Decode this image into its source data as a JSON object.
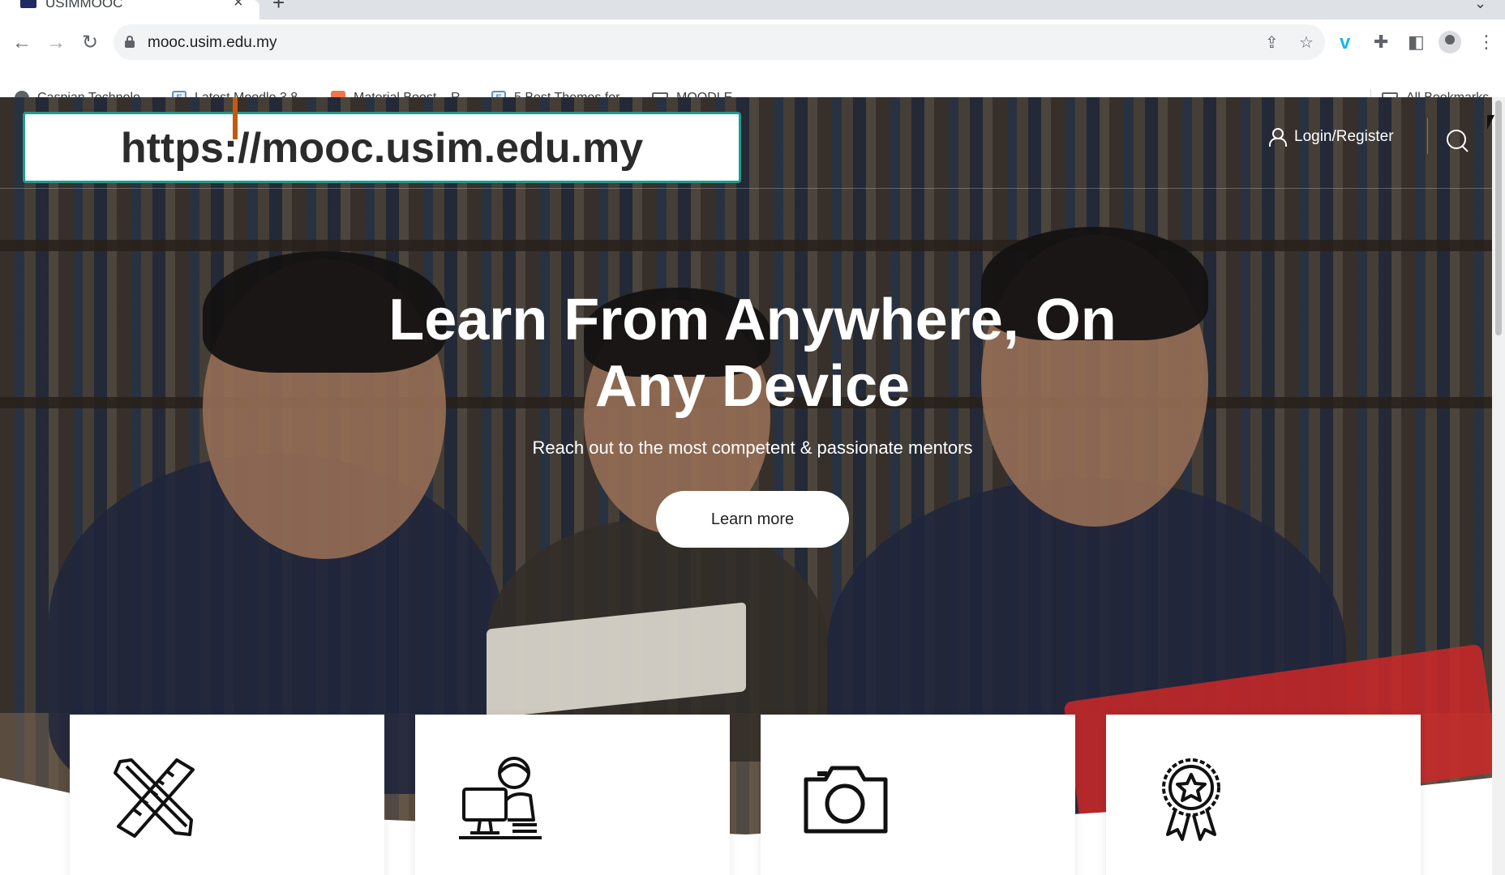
{
  "browser": {
    "tab_title": "USIMMOOC",
    "new_tab_label": "+",
    "url": "mooc.usim.edu.my",
    "bookmarks": [
      {
        "label": "Caspian Technolo..."
      },
      {
        "label": "Latest Moodle 3.8..."
      },
      {
        "label": "Material Boost – R..."
      },
      {
        "label": "5 Best Themes for..."
      },
      {
        "label": "MOODLE"
      }
    ],
    "all_bookmarks_label": "All Bookmarks"
  },
  "callout": {
    "url_text": "https://mooc.usim.edu.my"
  },
  "header": {
    "login_label": "Login/Register"
  },
  "hero": {
    "title_line1": "Learn From Anywhere, On",
    "title_line2": "Any Device",
    "subtitle": "Reach out to the most competent & passionate mentors",
    "cta_label": "Learn more"
  },
  "cards": [
    {
      "icon": "pencil-ruler-icon"
    },
    {
      "icon": "online-learner-icon"
    },
    {
      "icon": "camera-icon"
    },
    {
      "icon": "award-badge-icon"
    }
  ],
  "colors": {
    "callout_border": "#1f9c8c",
    "arrow": "#c25a12"
  }
}
